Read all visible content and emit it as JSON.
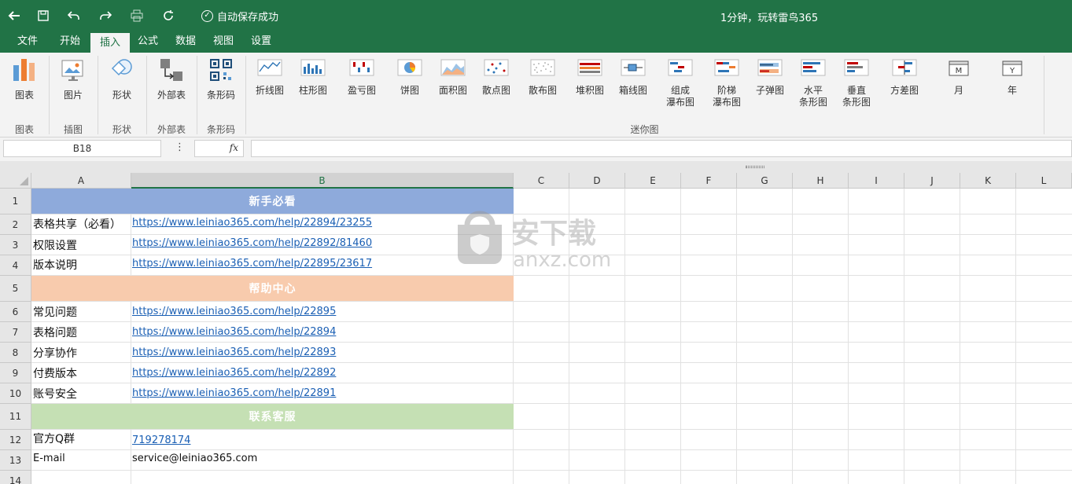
{
  "titlebar": {
    "autosave": "自动保存成功",
    "promo": "1分钟，玩转雷鸟365"
  },
  "tabs": [
    "文件",
    "开始",
    "插入",
    "公式",
    "数据",
    "视图",
    "设置"
  ],
  "active_tab": "插入",
  "ribbon": {
    "items": {
      "chart": "图表",
      "picture": "图片",
      "shape": "形状",
      "external": "外部表",
      "barcode": "条形码",
      "line": "折线图",
      "column": "柱形图",
      "winloss": "盈亏图",
      "pie": "饼图",
      "area": "面积图",
      "dot": "散点图",
      "scatter": "散布图",
      "stacked": "堆积图",
      "box": "箱线图",
      "composite_waterfall_1": "组成",
      "composite_waterfall_2": "瀑布图",
      "step_waterfall_1": "阶梯",
      "step_waterfall_2": "瀑布图",
      "bullet": "子弹图",
      "hbar_1": "水平",
      "hbar_2": "条形图",
      "vbar_1": "垂直",
      "vbar_2": "条形图",
      "variance": "方差图",
      "month": "月",
      "year": "年"
    },
    "groups": {
      "chart": "图表",
      "illustration": "插图",
      "shape": "形状",
      "external": "外部表",
      "barcode": "条形码",
      "sparkline": "迷你图"
    }
  },
  "formula_bar": {
    "name_box": "B18",
    "fx": "fx",
    "more": "⋮",
    "formula": ""
  },
  "columns": [
    "A",
    "B",
    "C",
    "D",
    "E",
    "F",
    "G",
    "H",
    "I",
    "J",
    "K",
    "L"
  ],
  "selected_column": "B",
  "rows": [
    "1",
    "2",
    "3",
    "4",
    "5",
    "6",
    "7",
    "8",
    "9",
    "10",
    "11",
    "12",
    "13",
    "14"
  ],
  "bands": {
    "r1": "新手必看",
    "r5": "帮助中心",
    "r11": "联系客服"
  },
  "band_colors": {
    "r1": "#8eaadb",
    "r5": "#f8cbad",
    "r11": "#c5e0b4"
  },
  "cells": {
    "A2": "表格共享（必看）",
    "B2": "https://www.leiniao365.com/help/22894/23255",
    "A3": "权限设置",
    "B3": "https://www.leiniao365.com/help/22892/81460",
    "A4": "版本说明",
    "B4": "https://www.leiniao365.com/help/22895/23617",
    "A6": "常见问题",
    "B6": "https://www.leiniao365.com/help/22895",
    "A7": "表格问题",
    "B7": "https://www.leiniao365.com/help/22894",
    "A8": "分享协作",
    "B8": "https://www.leiniao365.com/help/22893",
    "A9": "付费版本",
    "B9": "https://www.leiniao365.com/help/22892",
    "A10": "账号安全",
    "B10": "https://www.leiniao365.com/help/22891",
    "A12": "官方Q群",
    "B12": "719278174",
    "A13": "E-mail",
    "B13": "service@leiniao365.com"
  },
  "watermark": {
    "line1": "安下载",
    "line2": "anxz.com"
  },
  "colors": {
    "accent": "#217346",
    "link": "#1a5fb4"
  }
}
